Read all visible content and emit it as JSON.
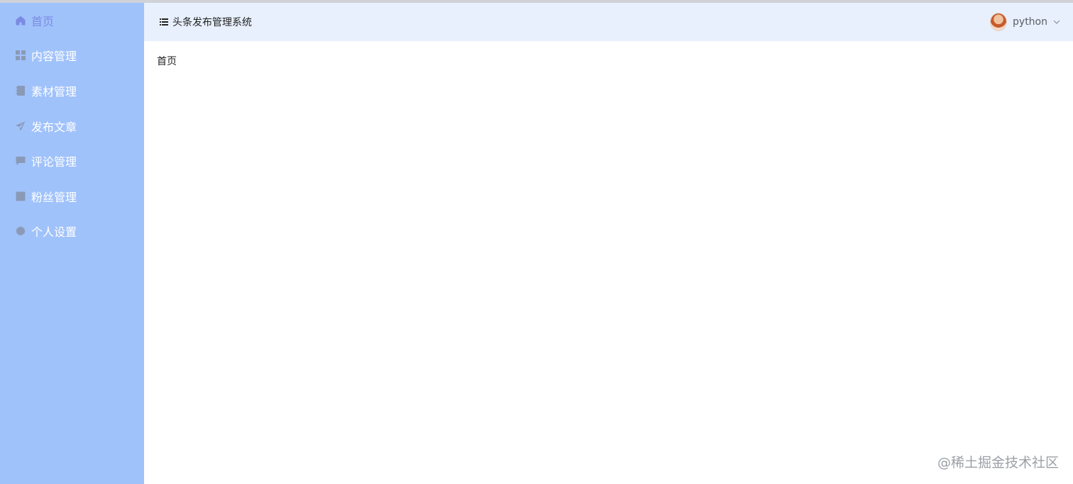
{
  "sidebar": {
    "items": [
      {
        "label": "首页",
        "icon": "home-icon",
        "active": true
      },
      {
        "label": "内容管理",
        "icon": "grid-icon"
      },
      {
        "label": "素材管理",
        "icon": "notebook-icon"
      },
      {
        "label": "发布文章",
        "icon": "send-icon"
      },
      {
        "label": "评论管理",
        "icon": "comment-icon"
      },
      {
        "label": "粉丝管理",
        "icon": "user-card-icon"
      },
      {
        "label": "个人设置",
        "icon": "settings-icon"
      }
    ]
  },
  "header": {
    "title": "头条发布管理系统",
    "username": "python"
  },
  "main": {
    "page_text": "首页"
  },
  "watermark": "@稀土掘金技术社区",
  "colors": {
    "sidebar_bg": "#a0c2fb",
    "header_bg": "#e8f0fd",
    "active_item": "#7b8be3"
  }
}
